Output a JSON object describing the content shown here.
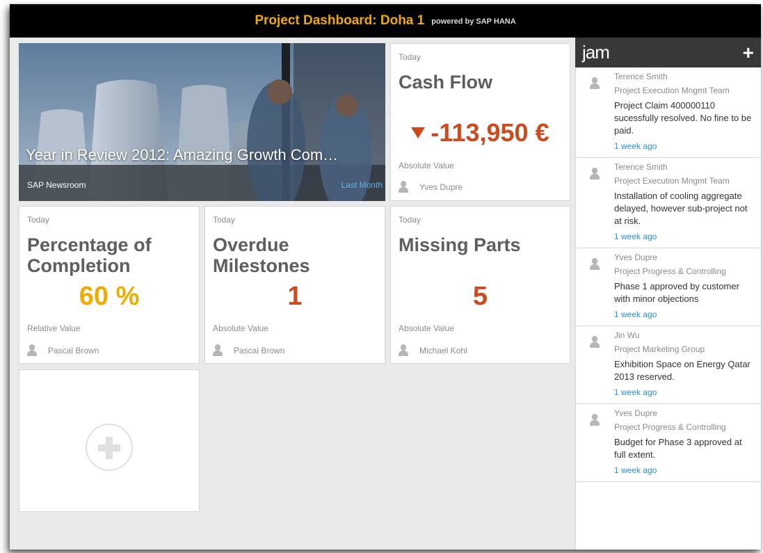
{
  "header": {
    "title": "Project Dashboard: Doha 1",
    "powered": "powered by SAP HANA"
  },
  "colors": {
    "accent": "#f0ab00",
    "negative": "#cc4b1e",
    "link": "#2a8fd6"
  },
  "news_tile": {
    "headline": "Year in Review 2012: Amazing Growth Com…",
    "source": "SAP Newsroom",
    "period": "Last Month"
  },
  "tiles": {
    "cash_flow": {
      "period": "Today",
      "title": "Cash Flow",
      "value": "-113,950 €",
      "trend_icon": "down-triangle",
      "value_type": "Absolute Value",
      "owner": "Yves Dupre"
    },
    "completion": {
      "period": "Today",
      "title_line1": "Percentage of",
      "title_line2": "Completion",
      "value": "60 %",
      "value_type": "Relative Value",
      "owner": "Pascal Brown"
    },
    "milestones": {
      "period": "Today",
      "title_line1": "Overdue",
      "title_line2": "Milestones",
      "value": "1",
      "value_type": "Absolute Value",
      "owner": "Pascal Brown"
    },
    "missing_parts": {
      "period": "Today",
      "title": "Missing Parts",
      "value": "5",
      "value_type": "Absolute Value",
      "owner": "Michael Kohl"
    }
  },
  "jam": {
    "logo": "jam",
    "add_label": "+",
    "feed": [
      {
        "name": "Terence Smith",
        "group": "Project Execution Mngmt Team",
        "message": "Project Claim 400000110 sucessfully resolved. No fine to be paid.",
        "time": "1 week ago"
      },
      {
        "name": "Terence Smith",
        "group": "Project Execution Mngmt Team",
        "message": "Installation of cooling aggregate delayed, however sub-project not at risk.",
        "time": "1 week ago"
      },
      {
        "name": "Yves Dupre",
        "group": "Project Progress & Controlling",
        "message": "Phase 1 approved by customer with minor objections",
        "time": "1 week ago"
      },
      {
        "name": "Jin Wu",
        "group": "Project Marketing Group",
        "message": "Exhibition Space on Energy Qatar 2013 reserved.",
        "time": "1 week ago"
      },
      {
        "name": "Yves Dupre",
        "group": "Project Progress & Controlling",
        "message": "Budget for Phase 3 approved at full extent.",
        "time": "1 week ago"
      }
    ]
  }
}
